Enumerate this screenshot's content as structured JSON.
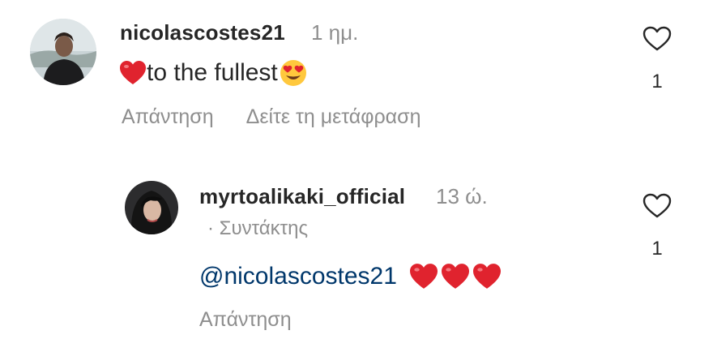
{
  "comments": [
    {
      "username": "nicolascostes21",
      "time": "1 ημ.",
      "text": "to the fullest",
      "like_count": "1",
      "actions": {
        "reply": "Απάντηση",
        "translate": "Δείτε τη μετάφραση"
      }
    },
    {
      "username": "myrtoalikaki_official",
      "time": "13 ώ.",
      "author_tag": "· Συντάκτης",
      "mention": "@nicolascostes21",
      "like_count": "1",
      "actions": {
        "reply": "Απάντηση"
      }
    }
  ],
  "icons": {
    "like": "heart-outline-icon",
    "emoji_heart": "red-heart-emoji",
    "emoji_face": "heart-eyes-emoji"
  },
  "colors": {
    "primary_text": "#262626",
    "secondary_text": "#8e8e8e",
    "mention": "#00376b",
    "heart_red": "#e0232e"
  }
}
